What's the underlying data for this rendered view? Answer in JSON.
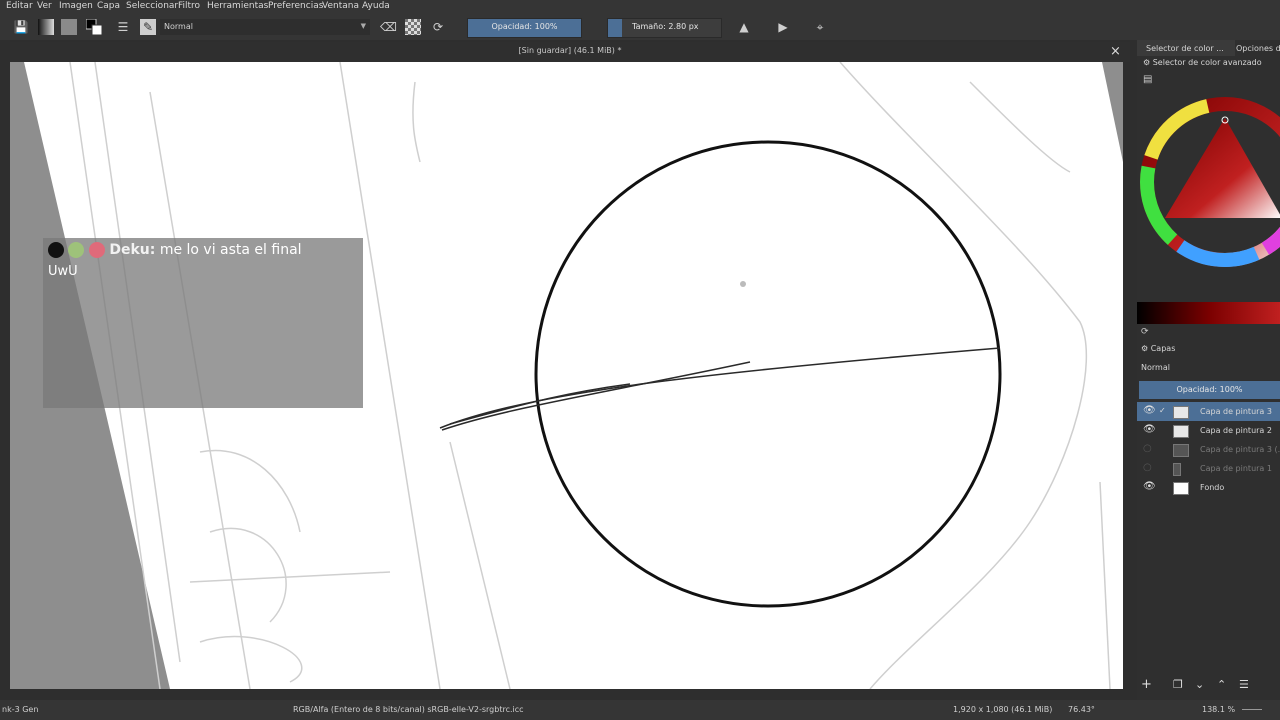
{
  "menu": [
    "Editar",
    "Ver",
    "Imagen",
    "Capa",
    "Seleccionar",
    "Filtro",
    "Herramientas",
    "Preferencias",
    "Ventana",
    "Ayuda"
  ],
  "toolbar": {
    "blend_mode": "Normal",
    "opacity_label": "Opacidad: 100%",
    "opacity_value": 1.0,
    "size_label": "Tamaño: 2.80 px"
  },
  "document": {
    "title": "[Sin guardar]  (46.1 MiB) *"
  },
  "overlay": {
    "username": "Deku:",
    "message": "me lo vi asta el final",
    "message_line2": "UwU"
  },
  "docker": {
    "tab1": "Selector de color ...",
    "tab2": "Opciones de",
    "color_selector_label": "Selector de color avanzado",
    "layers_title": "Capas",
    "layers_blend": "Normal",
    "layers_opacity": "Opacidad:  100%",
    "layers": [
      {
        "name": "Capa de pintura 3",
        "selected": true,
        "visible": true
      },
      {
        "name": "Capa de pintura 2",
        "selected": false,
        "visible": true
      },
      {
        "name": "Capa de pintura 3 (...",
        "selected": false,
        "visible": false
      },
      {
        "name": "Capa de pintura 1",
        "selected": false,
        "visible": false
      },
      {
        "name": "Fondo",
        "selected": false,
        "visible": true
      }
    ]
  },
  "status": {
    "brush": "nk-3 Gen",
    "color_profile": "RGB/Alfa (Entero de 8 bits/canal)  sRGB-elle-V2-srgbtrc.icc",
    "dimensions": "1,920 x 1,080 (46.1 MiB)",
    "rotation": "76.43°",
    "zoom": "138.1 %"
  },
  "colors": {
    "accent": "#4c6f96",
    "panel": "#353535",
    "canvas": "#ffffff"
  }
}
